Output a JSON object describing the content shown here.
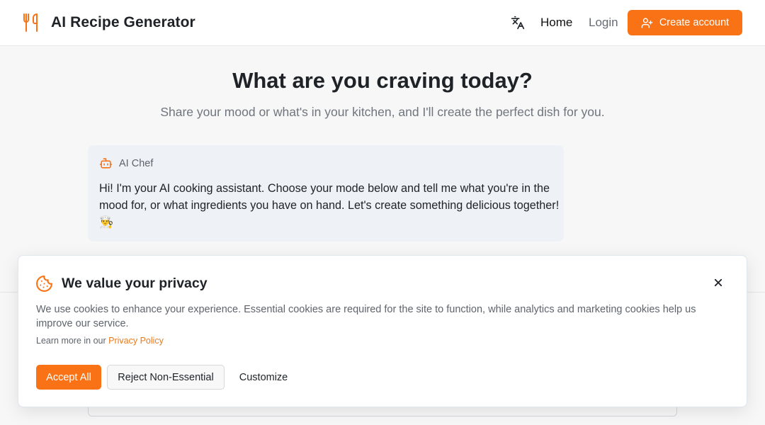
{
  "header": {
    "logo_icon": "utensils-icon",
    "title": "AI Recipe Generator",
    "language_icon": "translate-icon",
    "nav_home": "Home",
    "nav_login": "Login",
    "create_account_icon": "user-plus-icon",
    "create_account_label": "Create account"
  },
  "hero": {
    "title": "What are you craving today?",
    "subtitle": "Share your mood or what's in your kitchen, and I'll create the perfect dish for you."
  },
  "chat": {
    "sender_icon": "robot-icon",
    "sender": "AI Chef",
    "message": "Hi! I'm your AI cooking assistant. Choose your mode below and tell me what you're in the mood for, or what ingredients you have on hand. Let's create something delicious together! 👨‍🍳"
  },
  "cookie_banner": {
    "icon": "cookie-icon",
    "title": "We value your privacy",
    "description": "We use cookies to enhance your experience. Essential cookies are required for the site to function, while analytics and marketing cookies help us improve our service.",
    "learn_more_prefix": "Learn more in our ",
    "policy_link": "Privacy Policy",
    "accept_label": "Accept All",
    "reject_label": "Reject Non-Essential",
    "customize_label": "Customize",
    "close_icon": "close-icon"
  },
  "colors": {
    "accent": "#f97316",
    "link": "#ea7a1c",
    "bubble_bg": "#eef1f6",
    "page_bg": "#f7f7f8"
  }
}
